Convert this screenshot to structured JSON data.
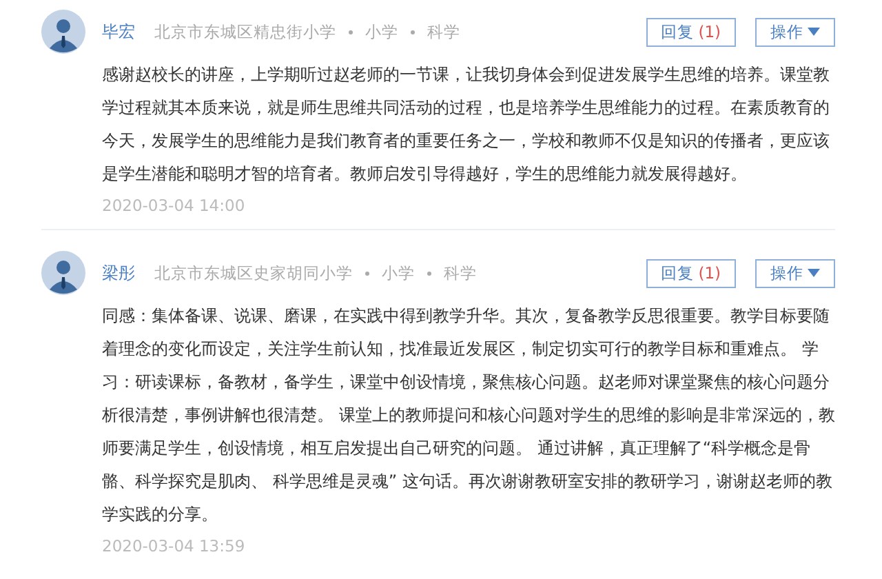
{
  "comments": [
    {
      "author": "毕宏",
      "meta": [
        "北京市东城区精忠街小学",
        "小学",
        "科学"
      ],
      "reply": {
        "label": "回复",
        "count": "(1)"
      },
      "action": "操作",
      "body": "感谢赵校长的讲座，上学期听过赵老师的一节课，让我切身体会到促进发展学生思维的培养。课堂教学过程就其本质来说，就是师生思维共同活动的过程，也是培养学生思维能力的过程。在素质教育的今天，发展学生的思维能力是我们教育者的重要任务之一，学校和教师不仅是知识的传播者，更应该是学生潜能和聪明才智的培育者。教师启发引导得越好，学生的思维能力就发展得越好。",
      "date": "2020-03-04 14:00"
    },
    {
      "author": "梁彤",
      "meta": [
        "北京市东城区史家胡同小学",
        "小学",
        "科学"
      ],
      "reply": {
        "label": "回复",
        "count": "(1)"
      },
      "action": "操作",
      "body": "同感：集体备课、说课、磨课，在实践中得到教学升华。其次，复备教学反思很重要。教学目标要随着理念的变化而设定，关注学生前认知，找准最近发展区，制定切实可行的教学目标和重难点。 学习：研读课标，备教材，备学生，课堂中创设情境，聚焦核心问题。赵老师对课堂聚焦的核心问题分析很清楚，事例讲解也很清楚。 课堂上的教师提问和核心问题对学生的思维的影响是非常深远的，教师要满足学生，创设情境，相互启发提出自己研究的问题。 通过讲解，真正理解了“科学概念是骨骼、科学探究是肌肉、 科学思维是灵魂” 这句话。再次谢谢教研室安排的教研学习，谢谢赵老师的教学实践的分享。",
      "date": "2020-03-04 13:59"
    }
  ]
}
